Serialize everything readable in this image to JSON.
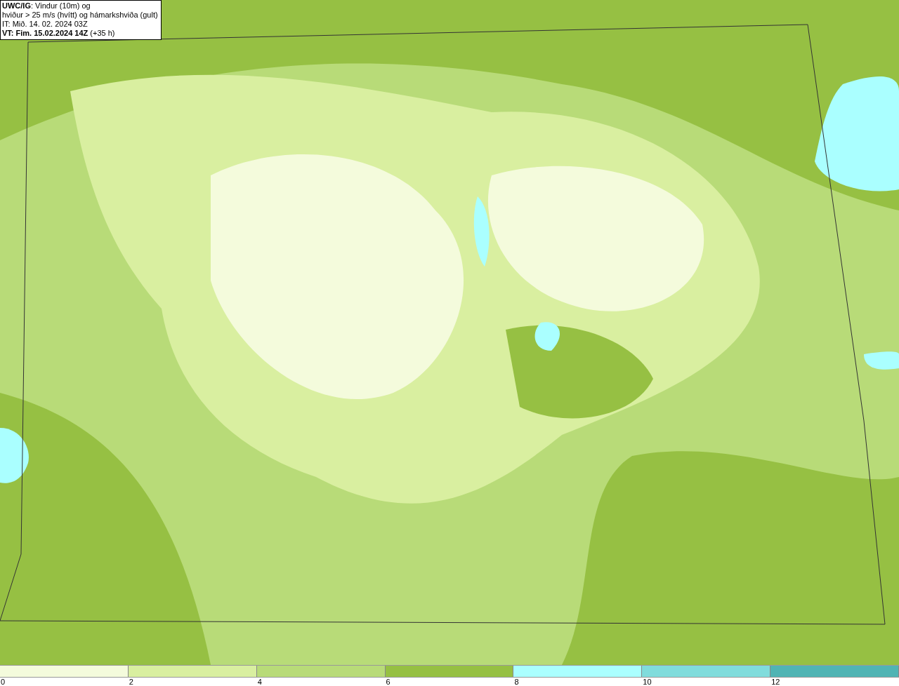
{
  "header": {
    "lines": [
      "**UWC/IG**: Vindur (10m) og",
      "hviður > 25 m/s (hvítt) og hámarkshviða (gult)",
      "IT: Mið. 14. 02. 2024 03Z",
      "**VT: Fim. 15.02.2024 14Z** (+35 h)"
    ]
  },
  "legend": {
    "bins": [
      {
        "color": "#f4fbdc"
      },
      {
        "color": "#d9efa0"
      },
      {
        "color": "#b8db78"
      },
      {
        "color": "#96c043"
      },
      {
        "color": "#aaffff"
      },
      {
        "color": "#80dcdc"
      },
      {
        "color": "#50b4b4"
      }
    ],
    "ticks": [
      "0",
      "2",
      "4",
      "6",
      "8",
      "10",
      "12"
    ]
  }
}
